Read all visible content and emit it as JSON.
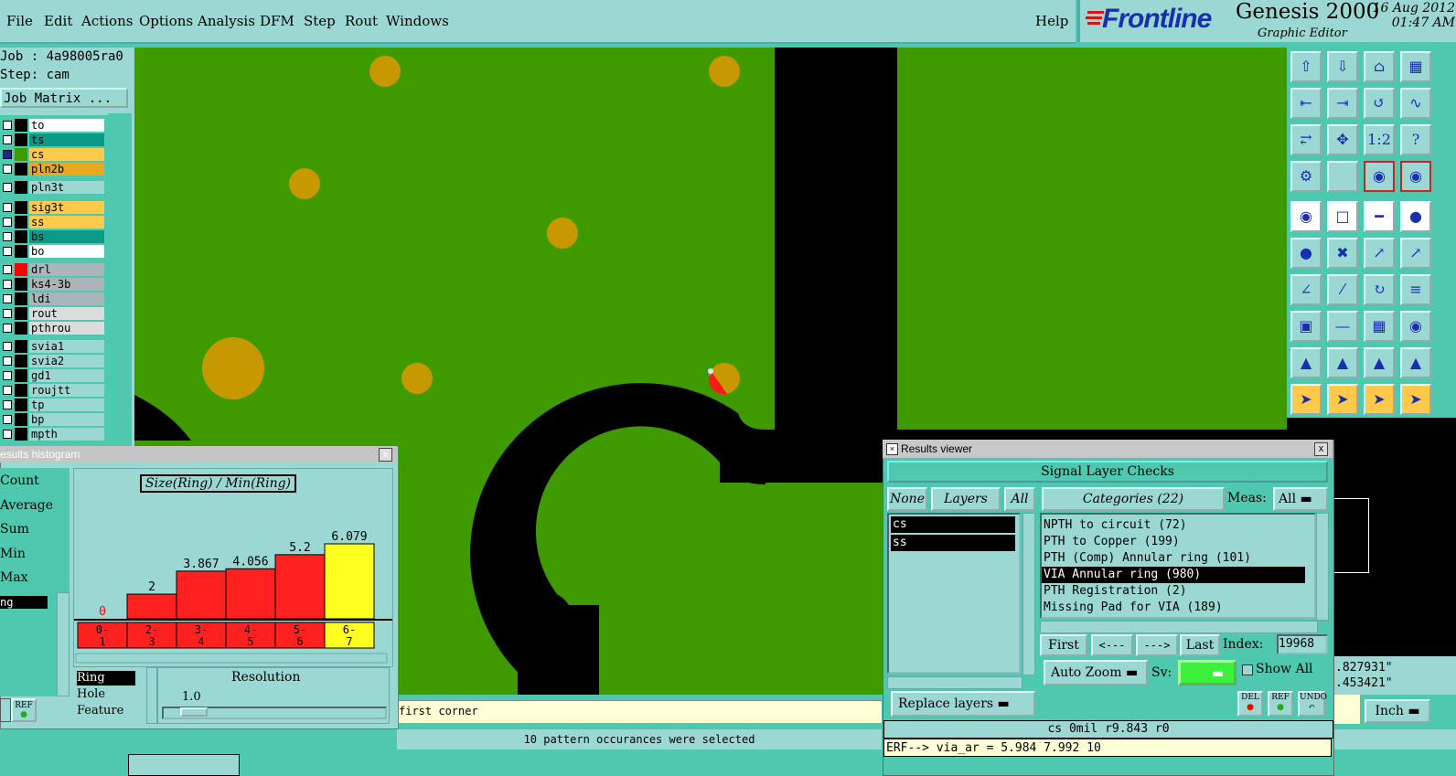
{
  "menu": {
    "items": [
      "File",
      "Edit",
      "Actions",
      "Options",
      "Analysis",
      "DFM",
      "Step",
      "Rout",
      "Windows"
    ],
    "help": "Help"
  },
  "brand": {
    "logo": "Frontline",
    "title": "Genesis 2000",
    "subtitle": "Graphic Editor",
    "date": "16 Aug 2012",
    "time": "01:47 AM"
  },
  "job": {
    "job_label": "Job : 4a98005ra0",
    "step_label": "Step: cam",
    "matrix_button": "Job Matrix ..."
  },
  "layers": [
    {
      "name": "to",
      "color": "#ffffff",
      "swatch": "#000000",
      "selected": false
    },
    {
      "name": "ts",
      "color": "#0a9a86",
      "swatch": "#000000",
      "selected": false
    },
    {
      "name": "cs",
      "color": "#ffc94a",
      "swatch": "#3f9a00",
      "selected": true
    },
    {
      "name": "pln2b",
      "color": "#e8a820",
      "swatch": "#000000",
      "selected": false
    },
    {
      "name": "pln3t",
      "color": "#9cd8d3",
      "swatch": "#000000",
      "selected": false
    },
    {
      "name": "sig3t",
      "color": "#ffc94a",
      "swatch": "#000000",
      "selected": false
    },
    {
      "name": "ss",
      "color": "#ffc94a",
      "swatch": "#000000",
      "selected": false
    },
    {
      "name": "bs",
      "color": "#0a9a86",
      "swatch": "#000000",
      "selected": false
    },
    {
      "name": "bo",
      "color": "#ffffff",
      "swatch": "#000000",
      "selected": false
    },
    {
      "name": "drl",
      "color": "#a9b5b8",
      "swatch": "#ff0000",
      "selected": false
    },
    {
      "name": "ks4-3b",
      "color": "#a9b5b8",
      "swatch": "#000000",
      "selected": false
    },
    {
      "name": "ldi",
      "color": "#a9b5b8",
      "swatch": "#000000",
      "selected": false
    },
    {
      "name": "rout",
      "color": "#dcdcdc",
      "swatch": "#000000",
      "selected": false
    },
    {
      "name": "pthrou",
      "color": "#dcdcdc",
      "swatch": "#000000",
      "selected": false
    },
    {
      "name": "svia1",
      "color": "#9cd8d3",
      "swatch": "#000000",
      "selected": false
    },
    {
      "name": "svia2",
      "color": "#9cd8d3",
      "swatch": "#000000",
      "selected": false
    },
    {
      "name": "gd1",
      "color": "#9cd8d3",
      "swatch": "#000000",
      "selected": false
    },
    {
      "name": "roujtt",
      "color": "#9cd8d3",
      "swatch": "#000000",
      "selected": false
    },
    {
      "name": "tp",
      "color": "#9cd8d3",
      "swatch": "#000000",
      "selected": false
    },
    {
      "name": "bp",
      "color": "#9cd8d3",
      "swatch": "#000000",
      "selected": false
    },
    {
      "name": "mpth",
      "color": "#9cd8d3",
      "swatch": "#000000",
      "selected": false
    }
  ],
  "histogram": {
    "title": "esults histogram",
    "close": "x",
    "stats": [
      "Count",
      "Average",
      "Sum",
      "Min",
      "Max"
    ],
    "selected_stat": "ng",
    "heading": "Size(Ring) / Min(Ring)",
    "bars": [
      {
        "label": "0",
        "bin": [
          "0-",
          "1"
        ],
        "value": 0,
        "color": "#ff2020",
        "label_color": "#ff0000"
      },
      {
        "label": "2",
        "bin": [
          "2-",
          "3"
        ],
        "value": 2,
        "color": "#ff2020",
        "label_color": "#000000"
      },
      {
        "label": "3.867",
        "bin": [
          "3-",
          "4"
        ],
        "value": 3.867,
        "color": "#ff2020",
        "label_color": "#000000"
      },
      {
        "label": "4.056",
        "bin": [
          "4-",
          "5"
        ],
        "value": 4.056,
        "color": "#ff2020",
        "label_color": "#000000"
      },
      {
        "label": "5.2",
        "bin": [
          "5-",
          "6"
        ],
        "value": 5.2,
        "color": "#ff2020",
        "label_color": "#000000"
      },
      {
        "label": "6.079",
        "bin": [
          "6-",
          "7"
        ],
        "value": 6.079,
        "color": "#ffff20",
        "label_color": "#000000"
      }
    ],
    "types": [
      "Ring",
      "Hole",
      "Feature"
    ],
    "selected_type": "Ring",
    "resolution_label": "Resolution",
    "resolution_value": "1.0",
    "ref_button": "REF"
  },
  "results": {
    "title": "Results viewer",
    "close": "x",
    "header": "Signal Layer Checks",
    "none_btn": "None",
    "layers_btn": "Layers",
    "all_btn": "All",
    "categories_btn": "Categories (22)",
    "meas_label": "Meas:",
    "meas_value": "All",
    "layers": [
      "cs",
      "ss"
    ],
    "categories": [
      {
        "text": "NPTH to circuit (72)",
        "selected": false
      },
      {
        "text": "PTH to Copper (199)",
        "selected": false
      },
      {
        "text": "PTH (Comp) Annular ring (101)",
        "selected": false
      },
      {
        "text": "VIA Annular ring (980)",
        "selected": true
      },
      {
        "text": "PTH Registration (2)",
        "selected": false
      },
      {
        "text": "Missing Pad for VIA (189)",
        "selected": false
      }
    ],
    "first_btn": "First",
    "prev_btn": "<---",
    "next_btn": "--->",
    "last_btn": "Last",
    "index_label": "Index:",
    "index_value": "19968",
    "autozoom_btn": "Auto Zoom",
    "sv_label": "Sv:",
    "showall_label": "Show All",
    "replace_btn": "Replace layers",
    "del_btn": "DEL",
    "ref_btn": "REF",
    "undo_btn": "UNDO",
    "info_line": "cs 0mil  r9.843  r0",
    "erf_line": "ERF--> via_ar = 5.984 7.992 10"
  },
  "status": {
    "prompt": "first corner",
    "message": "10 pattern occurances were selected",
    "coord_x": ".827931\"",
    "coord_y": ".453421\"",
    "units": "Inch"
  }
}
